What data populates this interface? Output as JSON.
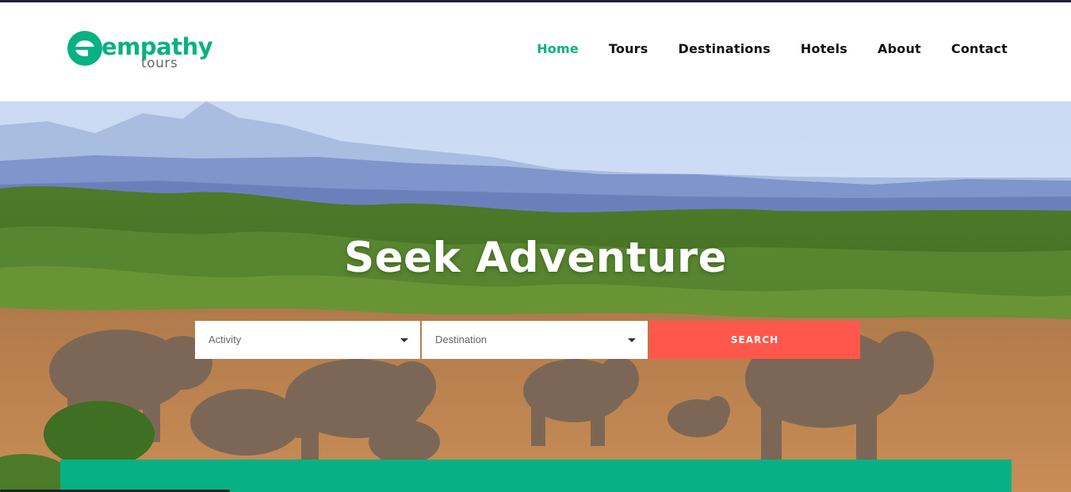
{
  "brand": {
    "name": "empathy",
    "tagline": "tours",
    "accent_color": "#08b183"
  },
  "nav": {
    "items": [
      {
        "label": "Home",
        "active": true
      },
      {
        "label": "Tours",
        "active": false
      },
      {
        "label": "Destinations",
        "active": false
      },
      {
        "label": "Hotels",
        "active": false
      },
      {
        "label": "About",
        "active": false
      },
      {
        "label": "Contact",
        "active": false
      }
    ]
  },
  "hero": {
    "title": "Seek Adventure",
    "background": "savanna-elephants-photo",
    "search": {
      "activity_placeholder": "Activity",
      "destination_placeholder": "Destination",
      "button_label": "SEARCH",
      "button_color": "#ff574b"
    }
  }
}
